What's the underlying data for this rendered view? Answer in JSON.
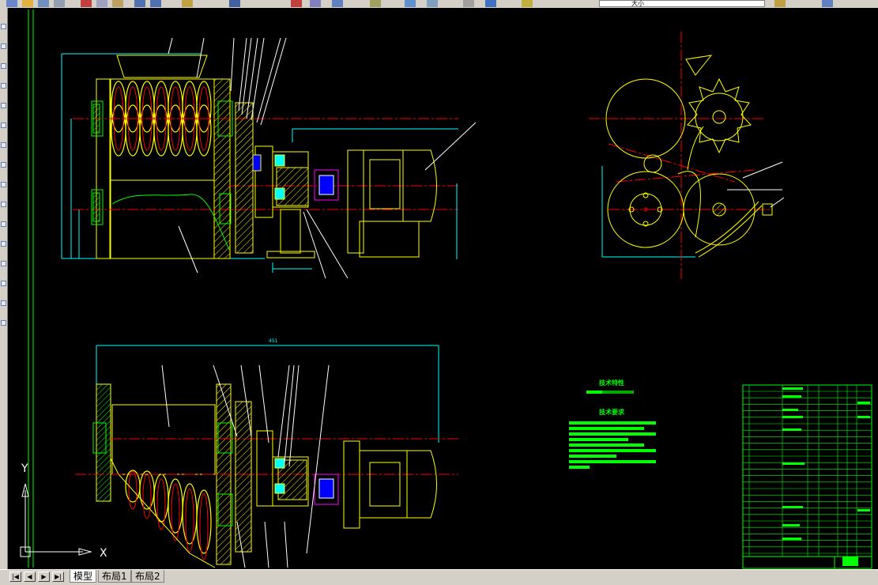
{
  "toolbar": {
    "layer_label": "大小",
    "icons": [
      "new-icon",
      "open-icon",
      "save-icon",
      "print-icon",
      "cut-icon",
      "copy-icon",
      "paste-icon",
      "undo-icon",
      "redo-icon",
      "pan-icon",
      "zoom-icon",
      "zoom-window-icon",
      "zoom-previous-icon",
      "properties-icon",
      "design-center-icon",
      "tool-palette-icon",
      "calculator-icon",
      "help-icon",
      "layer-manager-icon",
      "layer-state-icon",
      "match-properties-icon"
    ]
  },
  "tabs": {
    "model": "模型",
    "layout1": "布局1",
    "layout2": "布局2"
  },
  "ucs": {
    "x_label": "X",
    "y_label": "Y"
  },
  "drawing": {
    "tech_title": "技术特性",
    "req_title": "技术要求",
    "dimension_width": "451",
    "colors": {
      "background": "#000000",
      "yellow": "#ffff00",
      "green": "#00ff00",
      "red": "#ff0000",
      "cyan": "#00ffff",
      "magenta": "#ff00ff",
      "blue": "#0000ff",
      "white": "#ffffff"
    }
  }
}
